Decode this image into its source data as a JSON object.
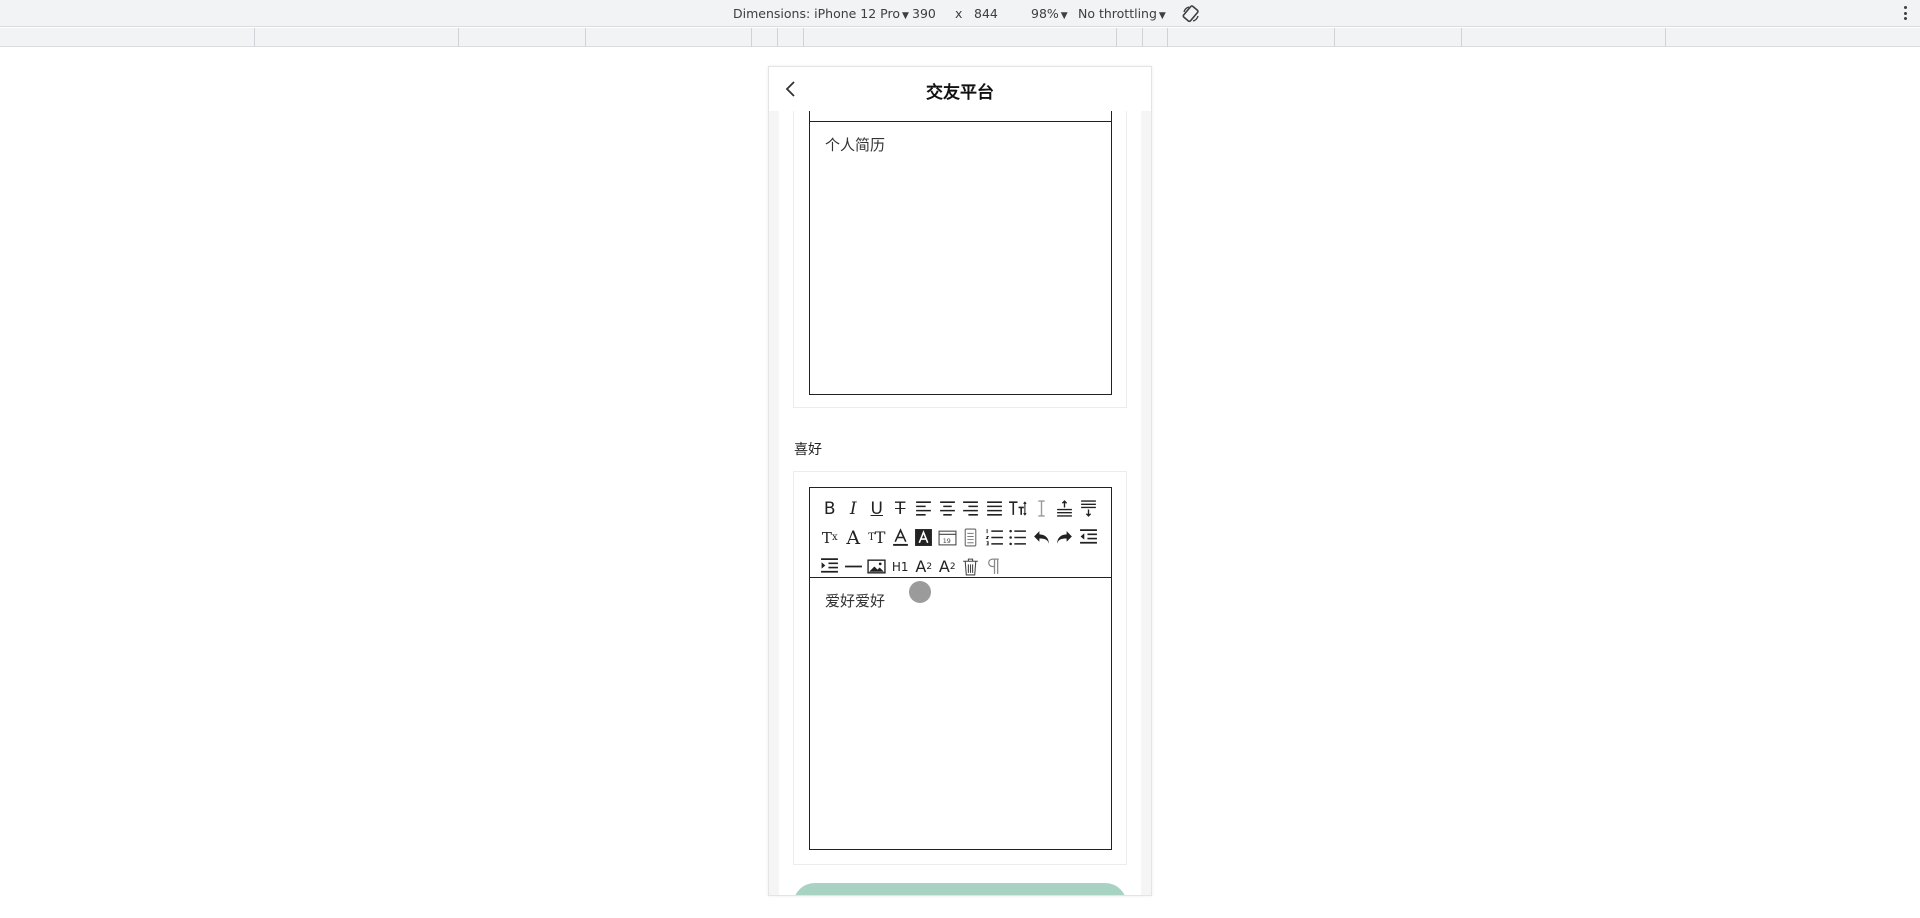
{
  "devtools": {
    "dimensions_label": "Dimensions: iPhone 12 Pro",
    "width": "390",
    "times": "x",
    "height": "844",
    "zoom": "98%",
    "throttling": "No throttling"
  },
  "nav": {
    "title": "交友平台"
  },
  "resume_editor": {
    "content": "个人简历"
  },
  "hobby": {
    "label": "喜好",
    "content": "爱好爱好"
  },
  "toolbar_icons": {
    "row1": [
      "bold-icon",
      "italic-icon",
      "underline-icon",
      "strikethrough-icon",
      "align-left-icon",
      "align-center-icon",
      "align-right-icon",
      "align-justify-icon",
      "font-size-icon",
      "line-height-icon",
      "spacing-top-icon",
      "spacing-bottom-icon"
    ],
    "row2": [
      "clear-format-icon",
      "font-family-icon",
      "text-case-icon",
      "font-color-icon",
      "background-color-icon",
      "date-icon",
      "table-icon",
      "ordered-list-icon",
      "unordered-list-icon",
      "undo-icon",
      "redo-icon",
      "outdent-icon"
    ],
    "row3": [
      "indent-icon",
      "horizontal-rule-icon",
      "image-icon",
      "heading-icon",
      "subscript-icon",
      "superscript-icon",
      "trash-icon",
      "paragraph-icon"
    ]
  },
  "colors": {
    "accent": "#a8d3c2",
    "border": "#222222"
  }
}
